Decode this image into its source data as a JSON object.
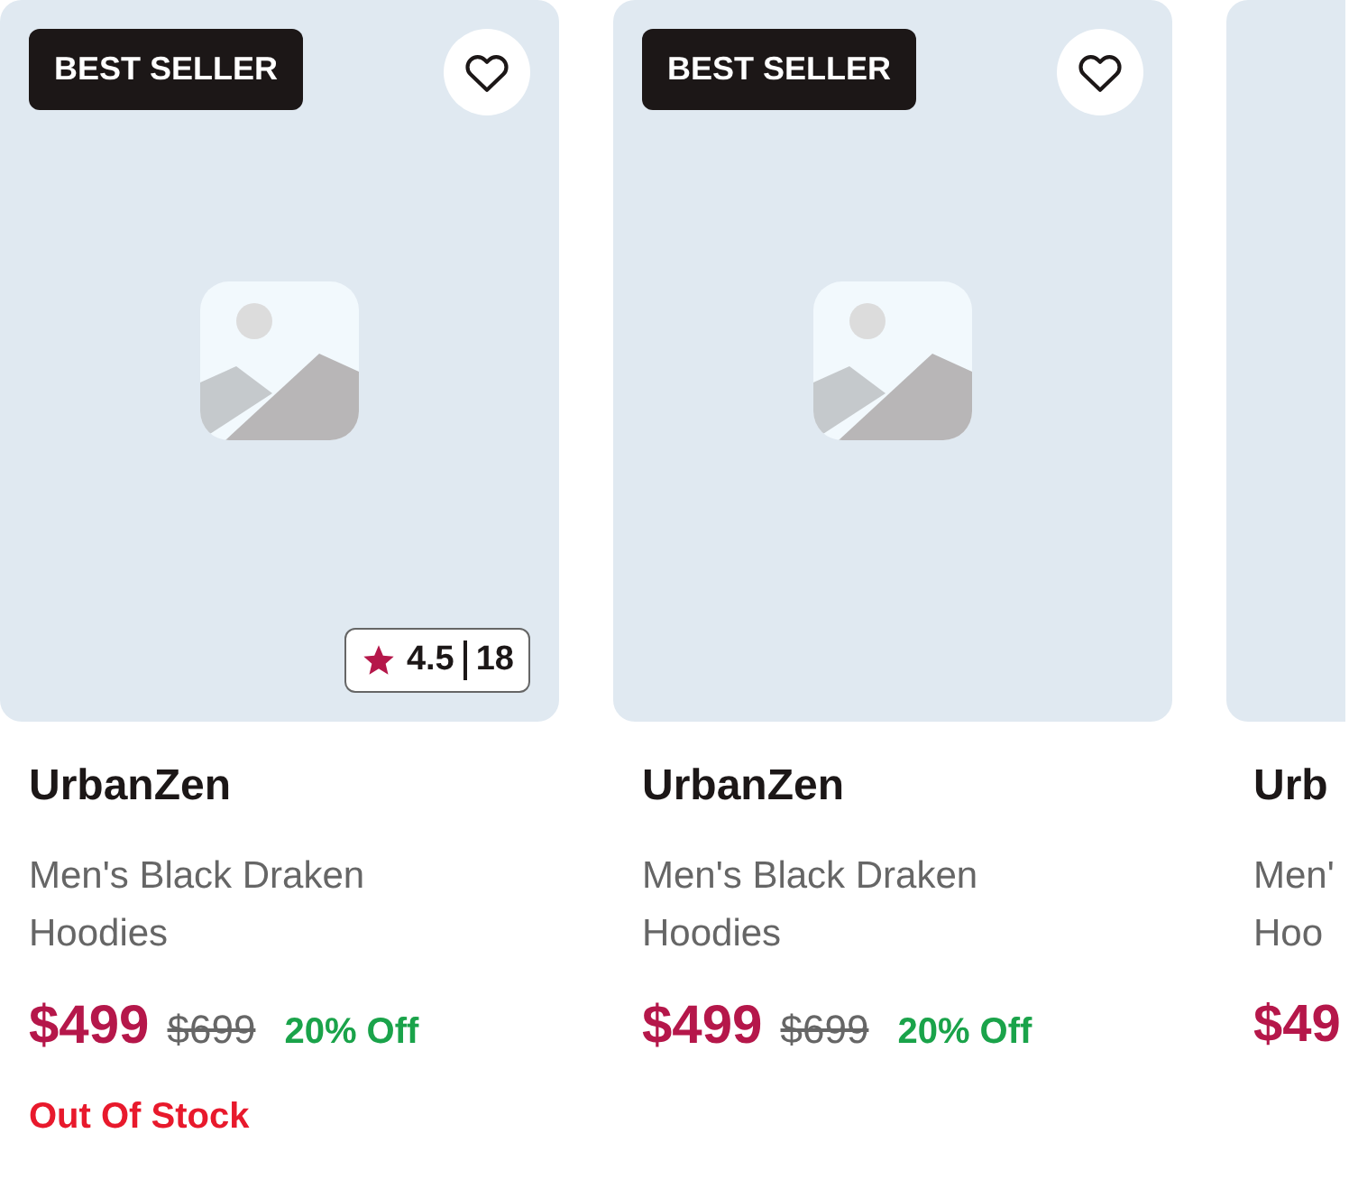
{
  "products": [
    {
      "badge": "BEST SELLER",
      "rating": "4.5",
      "reviews": "18",
      "brand": "UrbanZen",
      "description": [
        "Men's Black Draken",
        "Hoodies"
      ],
      "price": "$499",
      "original_price": "$699",
      "discount": "20% Off",
      "stock_status": "Out Of Stock"
    },
    {
      "badge": "BEST SELLER",
      "brand": "UrbanZen",
      "description": [
        "Men's Black Draken",
        "Hoodies"
      ],
      "price": "$499",
      "original_price": "$699",
      "discount": "20% Off"
    },
    {
      "brand": "Urb",
      "description": [
        "Men'",
        "Hoo"
      ],
      "price": "$49"
    }
  ]
}
